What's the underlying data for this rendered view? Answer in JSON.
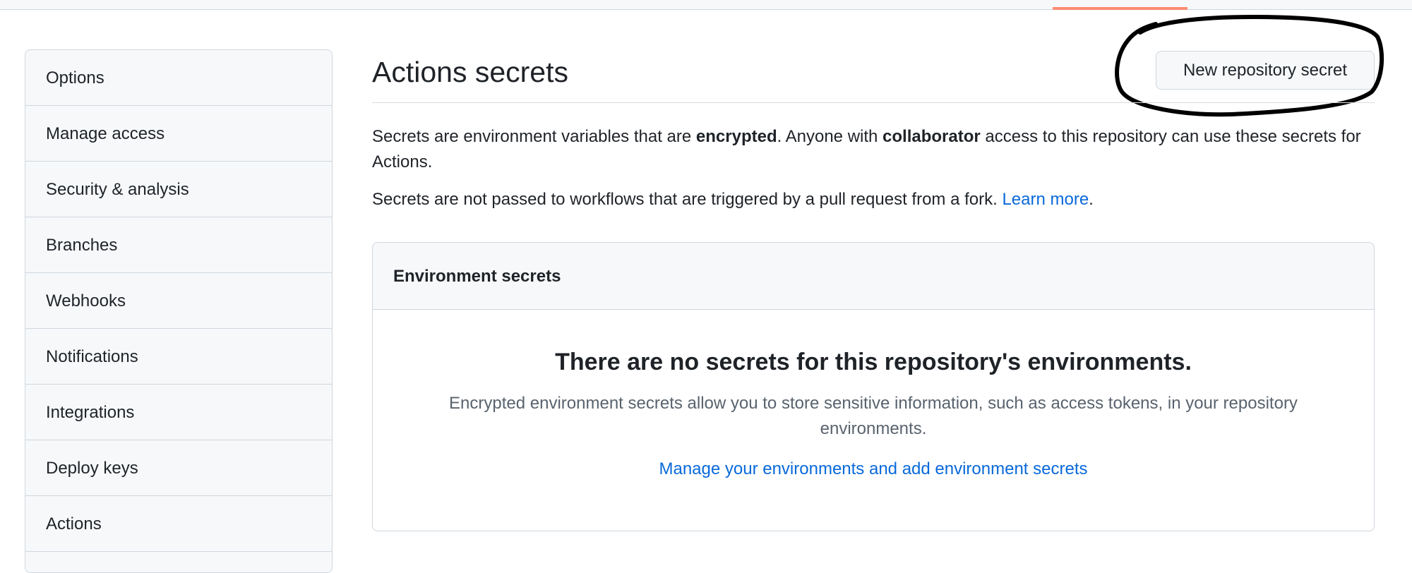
{
  "sidebar": {
    "items": [
      {
        "label": "Options"
      },
      {
        "label": "Manage access"
      },
      {
        "label": "Security & analysis"
      },
      {
        "label": "Branches"
      },
      {
        "label": "Webhooks"
      },
      {
        "label": "Notifications"
      },
      {
        "label": "Integrations"
      },
      {
        "label": "Deploy keys"
      },
      {
        "label": "Actions"
      }
    ]
  },
  "main": {
    "title": "Actions secrets",
    "new_secret_button": "New repository secret",
    "description": {
      "p1_part1": "Secrets are environment variables that are ",
      "p1_bold1": "encrypted",
      "p1_part2": ". Anyone with ",
      "p1_bold2": "collaborator",
      "p1_part3": " access to this repository can use these secrets for Actions.",
      "p2_text": "Secrets are not passed to workflows that are triggered by a pull request from a fork. ",
      "p2_link": "Learn more",
      "p2_end": "."
    },
    "environment_secrets": {
      "header": "Environment secrets",
      "empty_title": "There are no secrets for this repository's environments.",
      "empty_description": "Encrypted environment secrets allow you to store sensitive information, such as access tokens, in your repository environments.",
      "manage_link": "Manage your environments and add environment secrets"
    }
  },
  "colors": {
    "accent_link": "#0969da",
    "tab_underline": "#fd8c73",
    "annotation_stroke": "#000000"
  }
}
